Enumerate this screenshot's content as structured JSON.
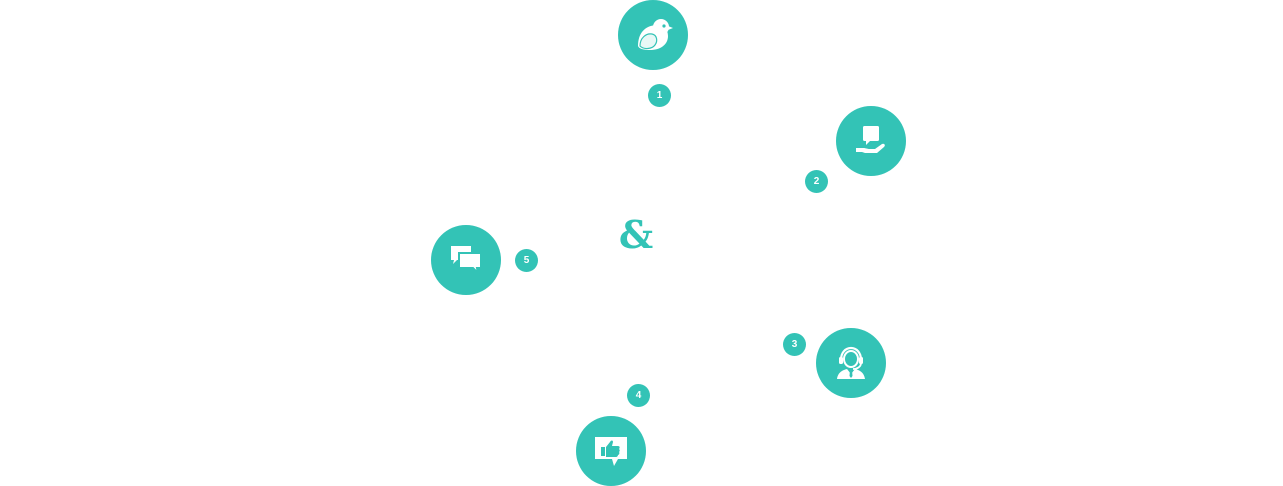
{
  "accent_color": "#33c3b6",
  "center_symbol": "&",
  "steps": [
    {
      "number": "1",
      "icon": "bird-icon"
    },
    {
      "number": "2",
      "icon": "hand-holding-message-icon"
    },
    {
      "number": "3",
      "icon": "support-agent-headset-icon"
    },
    {
      "number": "4",
      "icon": "thumbs-up-speech-bubble-icon"
    },
    {
      "number": "5",
      "icon": "chat-bubbles-icon"
    }
  ]
}
